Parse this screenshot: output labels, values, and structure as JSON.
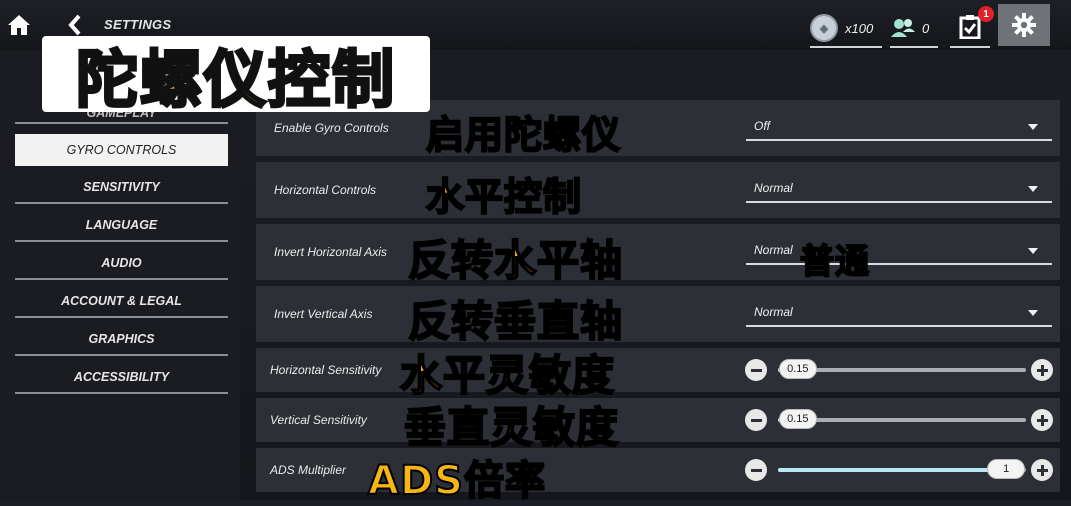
{
  "header": {
    "title": "SETTINGS",
    "currency_value": "x100",
    "friends_count": "0",
    "tasks_badge": "1",
    "icons": [
      "home-icon",
      "back-icon",
      "coin-icon",
      "friends-icon",
      "tasks-icon",
      "gear-icon"
    ]
  },
  "overlay": {
    "title": "陀螺仪控制"
  },
  "sidebar": {
    "items": [
      {
        "label": "GAMEPLAY"
      },
      {
        "label": "GYRO CONTROLS"
      },
      {
        "label": "SENSITIVITY"
      },
      {
        "label": "LANGUAGE"
      },
      {
        "label": "AUDIO"
      },
      {
        "label": "ACCOUNT & LEGAL"
      },
      {
        "label": "GRAPHICS"
      },
      {
        "label": "ACCESSIBILITY"
      }
    ]
  },
  "settings": {
    "enable_gyro": {
      "label": "Enable Gyro Controls",
      "value": "Off",
      "caption": "启用陀螺仪"
    },
    "horizontal_controls": {
      "label": "Horizontal Controls",
      "value": "Normal",
      "caption": "水平控制"
    },
    "invert_horizontal": {
      "label": "Invert Horizontal Axis",
      "value": "Normal",
      "caption": "反转水平轴",
      "value_caption": "普通"
    },
    "invert_vertical": {
      "label": "Invert Vertical Axis",
      "value": "Normal",
      "caption": "反转垂直轴"
    },
    "horizontal_sensitivity": {
      "label": "Horizontal Sensitivity",
      "value": "0.15",
      "caption": "水平灵敏度",
      "fraction": 0.08
    },
    "vertical_sensitivity": {
      "label": "Vertical Sensitivity",
      "value": "0.15",
      "caption": "垂直灵敏度",
      "fraction": 0.08
    },
    "ads_multiplier": {
      "label": "ADS Multiplier",
      "value": "1",
      "caption": "ADS倍率",
      "fraction": 0.92
    }
  },
  "colors": {
    "accent_caption": "#f7b614",
    "active_item_bg": "#f2f2f2",
    "slider_fill": "#b9e8f4",
    "badge": "#e0202a"
  }
}
